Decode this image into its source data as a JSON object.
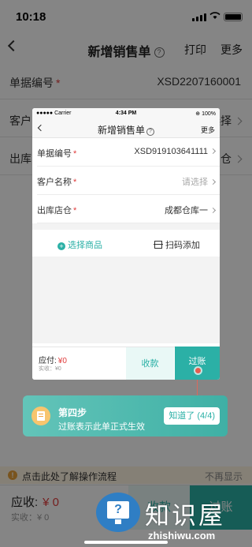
{
  "status": {
    "time": "10:18"
  },
  "navbar": {
    "title": "新增销售单",
    "help_glyph": "?",
    "print": "打印",
    "more": "更多"
  },
  "form": {
    "order_no_label": "单据编号",
    "order_no_value": "XSD2207160001",
    "customer_label": "客户",
    "customer_value": "选择",
    "warehouse_label": "出库",
    "warehouse_value": "仓",
    "required_mark": "*"
  },
  "tip": {
    "text": "点击此处了解操作流程",
    "dismiss": "不再显示",
    "icon": "!"
  },
  "bottom": {
    "due_label": "应收:",
    "due_value": "¥ 0",
    "paid": "实收：¥ 0",
    "collect": "收款",
    "post": "过账"
  },
  "card": {
    "status_left": "●●●●● Carrier ",
    "status_time": "4:34 PM",
    "status_right": "⊕ 100%",
    "title": "新增销售单",
    "help_glyph": "?",
    "more": "更多",
    "rows": [
      {
        "label": "单据编号",
        "value": "XSD919103641111"
      },
      {
        "label": "客户名称",
        "value": "请选择"
      },
      {
        "label": "出库店仓",
        "value": "成都仓库一"
      }
    ],
    "required_mark": "*",
    "add_goods": "选择商品",
    "add_icon": "+",
    "scan_add": "扫码添加",
    "due_label": "应付:",
    "due_value": "¥0",
    "paid": "实收：¥0",
    "collect": "收款",
    "post": "过账"
  },
  "guide": {
    "step": "第四步",
    "desc": "过账表示此单正式生效",
    "ok": "知道了 (4/4)"
  },
  "watermark": {
    "cn": "知识屋",
    "en": "zhishiwu.com",
    "glyph": "?"
  }
}
